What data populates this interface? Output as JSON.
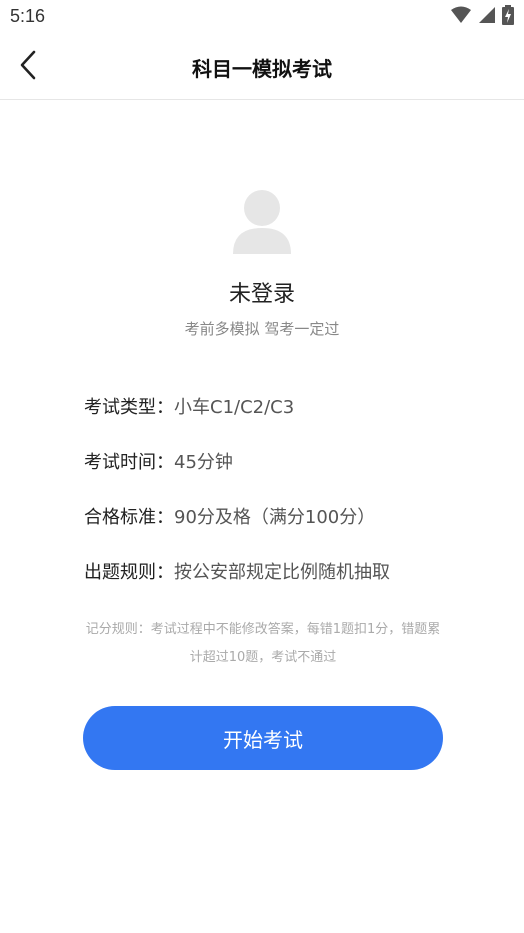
{
  "status_bar": {
    "time": "5:16",
    "icons": [
      "wifi-icon",
      "cellular-signal-icon",
      "battery-charging-icon"
    ]
  },
  "nav": {
    "title": "科目一模拟考试",
    "back_icon": "chevron-left-icon"
  },
  "profile": {
    "avatar_icon": "user-avatar-placeholder-icon",
    "login_status": "未登录",
    "slogan": "考前多模拟 驾考一定过"
  },
  "exam_info": [
    {
      "label": "考试类型：",
      "value": "小车C1/C2/C3"
    },
    {
      "label": "考试时间：",
      "value": "45分钟"
    },
    {
      "label": "合格标准：",
      "value": "90分及格（满分100分）"
    },
    {
      "label": "出题规则：",
      "value": "按公安部规定比例随机抽取"
    }
  ],
  "rules_note": "记分规则：考试过程中不能修改答案，每错1题扣1分，错题累计超过10题，考试不通过",
  "start_button_label": "开始考试",
  "colors": {
    "primary": "#3377f2",
    "avatar_gray": "#e6e6e6",
    "note_gray": "#aaaaaa"
  }
}
